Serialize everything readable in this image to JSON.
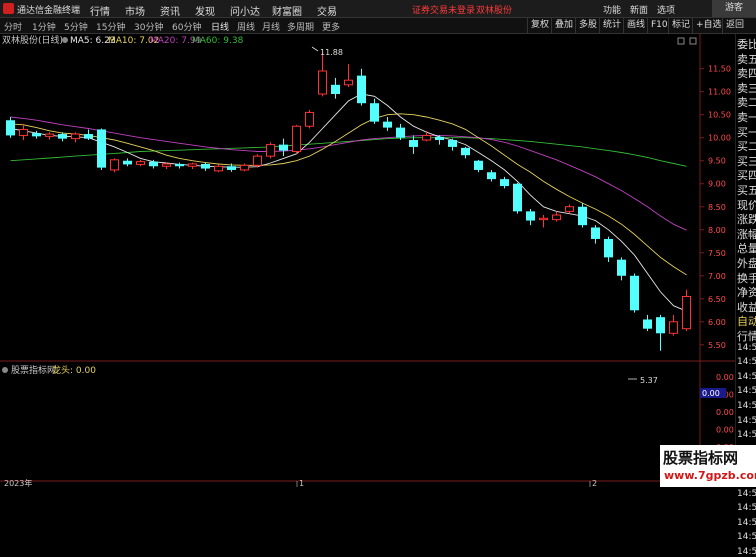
{
  "app": {
    "title": "通达信金融终端"
  },
  "menu": [
    "行情",
    "市场",
    "资讯",
    "发现",
    "问小达",
    "财富圈",
    "交易"
  ],
  "alert": "证券交易未登录",
  "stock_name": "双林股份",
  "right_menu": [
    "功能",
    "新面",
    "选项"
  ],
  "guest": "游客",
  "periods": [
    "分时",
    "1分钟",
    "5分钟",
    "15分钟",
    "30分钟",
    "60分钟",
    "日线",
    "周线",
    "月线",
    "多周期",
    "更多"
  ],
  "active_period": "日线",
  "tools": [
    "复权",
    "叠加",
    "多股",
    "统计",
    "画线",
    "F10",
    "标记",
    "+自选",
    "返回"
  ],
  "main_panel": {
    "name": "双林股份(日线)",
    "ma": [
      {
        "label": "MA5: 6.23",
        "color": "#e8e8e8"
      },
      {
        "label": "MA10: 7.02",
        "color": "#e6d25a"
      },
      {
        "label": "MA20: 7.99",
        "color": "#c040c0"
      },
      {
        "label": "MA60: 9.38",
        "color": "#33bb33"
      }
    ],
    "y_ticks": [
      "11.50",
      "11.00",
      "10.50",
      "10.00",
      "9.50",
      "9.00",
      "8.50",
      "8.00",
      "7.50",
      "7.00",
      "6.50",
      "6.00",
      "5.50"
    ],
    "high_mark": "11.88",
    "low_mark": "5.37"
  },
  "sub_panel": {
    "name": "股票指标网",
    "indicator": "龙头: 0.00",
    "y_ticks": [
      "0.00",
      "0.00",
      "0.00",
      "0.00",
      "0.00",
      "0.00"
    ],
    "current": "0.00"
  },
  "x_axis": {
    "year_label": "2023年",
    "month_marks": [
      "1",
      "2"
    ]
  },
  "side_labels": [
    "委比",
    "卖五",
    "卖四",
    "卖三",
    "卖二",
    "卖一",
    "买一",
    "买二",
    "买三",
    "买四",
    "买五",
    "现价",
    "涨跌",
    "涨幅",
    "总量",
    "外盘",
    "换手",
    "净资",
    "收益",
    "自动",
    "行情",
    "14:56",
    "14:56",
    "14:56",
    "14:56",
    "14:56",
    "14:56",
    "14:56",
    "14:56",
    "14:56",
    "14:56",
    "14:56",
    "14:56",
    "14:57",
    "14:57",
    "14:57"
  ],
  "watermark": {
    "line1": "股票指标网",
    "line2": "www.7gpzb.com"
  },
  "colors": {
    "up": "#ff3232",
    "down": "#54ffff",
    "ma5": "#e8e8e8",
    "ma10": "#e6d25a",
    "ma20": "#c040c0",
    "ma60": "#33bb33",
    "alert": "#ff3b3b"
  },
  "chart_data": {
    "type": "candlestick",
    "y_range": [
      5.3,
      11.95
    ],
    "candles": [
      [
        10.38,
        10.05,
        10.45,
        10.0
      ],
      [
        10.05,
        10.18,
        10.3,
        9.95
      ],
      [
        10.1,
        10.03,
        10.15,
        9.98
      ],
      [
        10.03,
        10.08,
        10.12,
        9.96
      ],
      [
        10.08,
        9.98,
        10.12,
        9.92
      ],
      [
        9.98,
        10.08,
        10.12,
        9.9
      ],
      [
        10.08,
        9.98,
        10.18,
        9.95
      ],
      [
        10.18,
        9.35,
        10.2,
        9.3
      ],
      [
        9.3,
        9.52,
        9.55,
        9.25
      ],
      [
        9.5,
        9.42,
        9.55,
        9.38
      ],
      [
        9.42,
        9.48,
        9.52,
        9.38
      ],
      [
        9.48,
        9.38,
        9.52,
        9.33
      ],
      [
        9.38,
        9.43,
        9.46,
        9.32
      ],
      [
        9.43,
        9.38,
        9.46,
        9.33
      ],
      [
        9.38,
        9.43,
        9.46,
        9.32
      ],
      [
        9.43,
        9.33,
        9.46,
        9.28
      ],
      [
        9.28,
        9.38,
        9.42,
        9.25
      ],
      [
        9.38,
        9.3,
        9.44,
        9.26
      ],
      [
        9.3,
        9.4,
        9.44,
        9.27
      ],
      [
        9.4,
        9.6,
        9.64,
        9.35
      ],
      [
        9.6,
        9.85,
        9.9,
        9.55
      ],
      [
        9.85,
        9.72,
        9.98,
        9.6
      ],
      [
        9.7,
        10.25,
        10.28,
        9.65
      ],
      [
        10.25,
        10.55,
        10.6,
        10.2
      ],
      [
        10.95,
        11.45,
        11.88,
        10.9
      ],
      [
        11.15,
        10.95,
        11.3,
        10.85
      ],
      [
        11.15,
        11.25,
        11.6,
        11.1
      ],
      [
        11.35,
        10.75,
        11.5,
        10.7
      ],
      [
        10.75,
        10.35,
        10.85,
        10.3
      ],
      [
        10.35,
        10.22,
        10.45,
        10.15
      ],
      [
        10.22,
        10.0,
        10.3,
        9.95
      ],
      [
        9.95,
        9.8,
        10.05,
        9.65
      ],
      [
        9.95,
        10.05,
        10.15,
        9.92
      ],
      [
        10.02,
        9.95,
        10.05,
        9.85
      ],
      [
        9.95,
        9.8,
        9.98,
        9.72
      ],
      [
        9.78,
        9.62,
        9.8,
        9.55
      ],
      [
        9.5,
        9.3,
        9.52,
        9.25
      ],
      [
        9.25,
        9.1,
        9.3,
        9.05
      ],
      [
        9.1,
        8.95,
        9.15,
        8.9
      ],
      [
        9.0,
        8.4,
        9.02,
        8.35
      ],
      [
        8.4,
        8.2,
        8.45,
        8.1
      ],
      [
        8.22,
        8.25,
        8.32,
        8.05
      ],
      [
        8.22,
        8.32,
        8.4,
        8.18
      ],
      [
        8.4,
        8.5,
        8.55,
        8.35
      ],
      [
        8.5,
        8.1,
        8.58,
        8.05
      ],
      [
        8.05,
        7.8,
        8.1,
        7.7
      ],
      [
        7.8,
        7.4,
        7.85,
        7.3
      ],
      [
        7.35,
        7.0,
        7.4,
        6.9
      ],
      [
        7.0,
        6.25,
        7.05,
        6.2
      ],
      [
        6.05,
        5.85,
        6.15,
        5.8
      ],
      [
        6.1,
        5.75,
        6.15,
        5.37
      ],
      [
        5.75,
        6.0,
        6.15,
        5.7
      ],
      [
        5.85,
        6.55,
        6.7,
        5.8
      ]
    ],
    "ma5": [
      10.2,
      10.15,
      10.1,
      10.05,
      10.03,
      10.02,
      10.0,
      9.9,
      9.8,
      9.68,
      9.55,
      9.48,
      9.45,
      9.42,
      9.4,
      9.38,
      9.37,
      9.36,
      9.36,
      9.37,
      9.45,
      9.55,
      9.65,
      9.9,
      10.2,
      10.5,
      10.8,
      10.95,
      10.9,
      10.7,
      10.45,
      10.25,
      10.12,
      10.02,
      9.95,
      9.85,
      9.68,
      9.5,
      9.3,
      9.05,
      8.75,
      8.5,
      8.4,
      8.35,
      8.3,
      8.2,
      8.0,
      7.75,
      7.45,
      7.05,
      6.65,
      6.35,
      6.23
    ],
    "ma10": [
      10.3,
      10.28,
      10.22,
      10.15,
      10.1,
      10.08,
      10.05,
      10.0,
      9.95,
      9.88,
      9.8,
      9.72,
      9.62,
      9.55,
      9.5,
      9.46,
      9.43,
      9.41,
      9.4,
      9.4,
      9.41,
      9.44,
      9.5,
      9.6,
      9.75,
      9.92,
      10.1,
      10.28,
      10.42,
      10.5,
      10.52,
      10.5,
      10.45,
      10.38,
      10.3,
      10.18,
      10.0,
      9.82,
      9.62,
      9.42,
      9.25,
      9.05,
      8.88,
      8.72,
      8.58,
      8.45,
      8.3,
      8.12,
      7.9,
      7.65,
      7.4,
      7.2,
      7.02
    ],
    "ma20": [
      10.45,
      10.42,
      10.38,
      10.33,
      10.28,
      10.24,
      10.2,
      10.15,
      10.1,
      10.05,
      10.0,
      9.96,
      9.92,
      9.88,
      9.84,
      9.8,
      9.77,
      9.74,
      9.72,
      9.7,
      9.7,
      9.71,
      9.73,
      9.76,
      9.8,
      9.85,
      9.9,
      9.95,
      9.98,
      10.0,
      10.02,
      10.04,
      10.05,
      10.05,
      10.04,
      10.02,
      10.0,
      9.96,
      9.9,
      9.82,
      9.72,
      9.62,
      9.52,
      9.4,
      9.28,
      9.15,
      9.0,
      8.85,
      8.68,
      8.5,
      8.3,
      8.12,
      7.99
    ],
    "ma60": [
      9.5,
      9.52,
      9.54,
      9.56,
      9.58,
      9.6,
      9.62,
      9.64,
      9.66,
      9.68,
      9.7,
      9.71,
      9.72,
      9.73,
      9.74,
      9.75,
      9.76,
      9.77,
      9.78,
      9.79,
      9.8,
      9.82,
      9.84,
      9.86,
      9.88,
      9.9,
      9.92,
      9.94,
      9.96,
      9.98,
      9.99,
      10.0,
      10.0,
      10.0,
      10.0,
      10.0,
      9.99,
      9.98,
      9.96,
      9.94,
      9.92,
      9.89,
      9.86,
      9.83,
      9.8,
      9.76,
      9.72,
      9.68,
      9.63,
      9.57,
      9.5,
      9.44,
      9.38
    ]
  }
}
